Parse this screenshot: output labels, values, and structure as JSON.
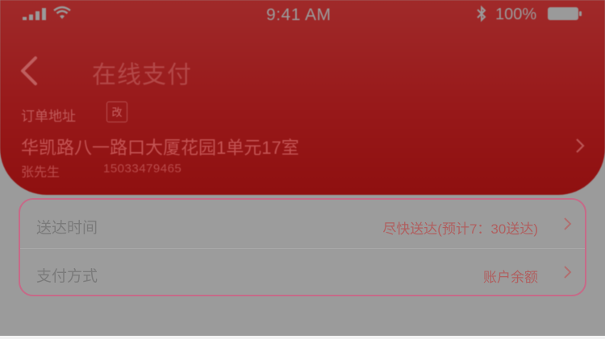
{
  "status_bar": {
    "time": "9:41 AM",
    "battery": "100%",
    "icons": [
      "signal-icon",
      "wifi-icon",
      "bluetooth-icon",
      "battery-icon"
    ]
  },
  "header": {
    "title": "在线支付",
    "back_icon": "back-arrow-icon",
    "background_color": "#98191a"
  },
  "address": {
    "label": "订单地址",
    "tag": "改",
    "text": "华凯路八一路口大厦花园1单元17室",
    "receiver": "张先生",
    "phone": "15033479465"
  },
  "options": [
    {
      "label": "送达时间",
      "value": "尽快送达(预计7：30送达)"
    },
    {
      "label": "支付方式",
      "value": "账户余额"
    }
  ],
  "colors": {
    "accent": "#98191a",
    "value_text": "#b06060",
    "card_border": "#c66a88"
  }
}
